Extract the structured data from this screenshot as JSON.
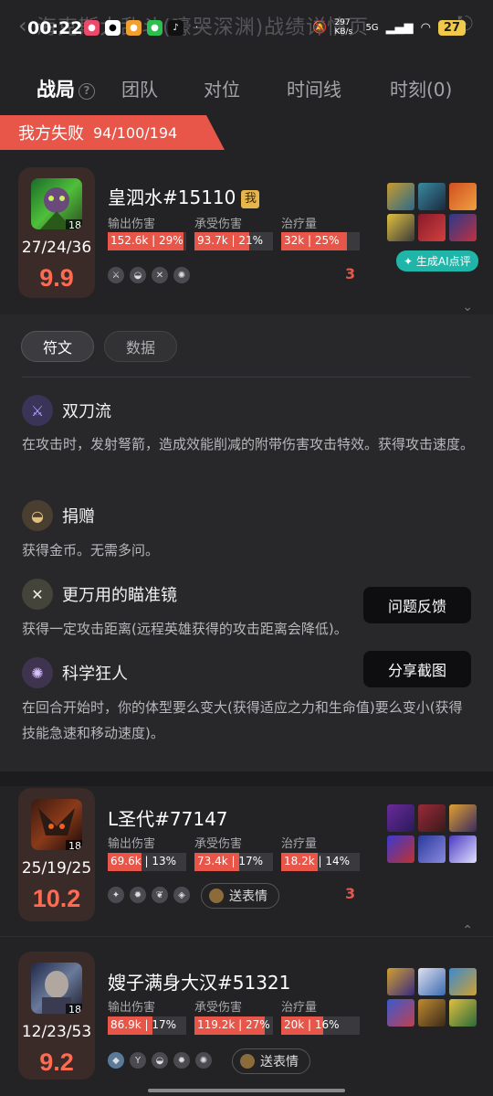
{
  "status_bar": {
    "time": "00:22",
    "faded_title": "海克斯大乱斗(嚎哭深渊)战绩详情页",
    "net_speed": "297 KB/s",
    "signal": "5G",
    "battery": "27"
  },
  "tabs": [
    {
      "label": "战局",
      "active": true
    },
    {
      "label": "团队"
    },
    {
      "label": "对位"
    },
    {
      "label": "时间线"
    },
    {
      "label": "时刻(0)"
    }
  ],
  "help_icon": "?",
  "result": {
    "label": "我方失败",
    "score": "94/100/194"
  },
  "stat_labels": {
    "damage": "输出伤害",
    "taken": "承受伤害",
    "heal": "治疗量"
  },
  "players": [
    {
      "name": "皇泗水#15110",
      "is_me": true,
      "me_badge": "我",
      "level": "18",
      "kda": "27/24/36",
      "rating": "9.9",
      "damage": "152.6k | 29%",
      "damage_pct": 0.29,
      "taken": "93.7k | 21%",
      "taken_pct": 0.21,
      "heal": "32k | 25%",
      "heal_pct": 0.25,
      "marker": "3",
      "ai_button": "✦ 生成AI点评"
    },
    {
      "name": "L圣代#77147",
      "level": "18",
      "kda": "25/19/25",
      "rating": "10.2",
      "damage": "69.6k | 13%",
      "damage_pct": 0.13,
      "taken": "73.4k | 17%",
      "taken_pct": 0.17,
      "heal": "18.2k | 14%",
      "heal_pct": 0.14,
      "marker": "3",
      "emote": "送表情"
    },
    {
      "name": "嫂子满身大汉#51321",
      "level": "18",
      "kda": "12/23/53",
      "rating": "9.2",
      "damage": "86.9k | 17%",
      "damage_pct": 0.17,
      "taken": "119.2k | 27%",
      "taken_pct": 0.27,
      "heal": "20k | 16%",
      "heal_pct": 0.16,
      "emote": "送表情"
    }
  ],
  "rune_tabs": {
    "runes": "符文",
    "data": "数据"
  },
  "runes": [
    {
      "name": "双刀流",
      "icon": "dual-blade-icon",
      "desc": "在攻击时，发射弩箭，造成效能削减的附带伤害攻击特效。获得攻击速度。"
    },
    {
      "name": "捐赠",
      "icon": "donation-icon",
      "desc": "获得金币。无需多问。"
    },
    {
      "name": "更万用的瞄准镜",
      "icon": "scope-icon",
      "desc": "获得一定攻击距离(远程英雄获得的攻击距离会降低)。"
    },
    {
      "name": "科学狂人",
      "icon": "mad-scientist-icon",
      "desc": "在回合开始时，你的体型要么变大(获得适应之力和生命值)要么变小(获得技能急速和移动速度)。"
    }
  ],
  "float_buttons": {
    "feedback": "问题反馈",
    "share": "分享截图"
  },
  "colors": {
    "accent_red": "#e8564a",
    "ai_teal": "#1fb5a8",
    "me_gold": "#e6b54c"
  }
}
